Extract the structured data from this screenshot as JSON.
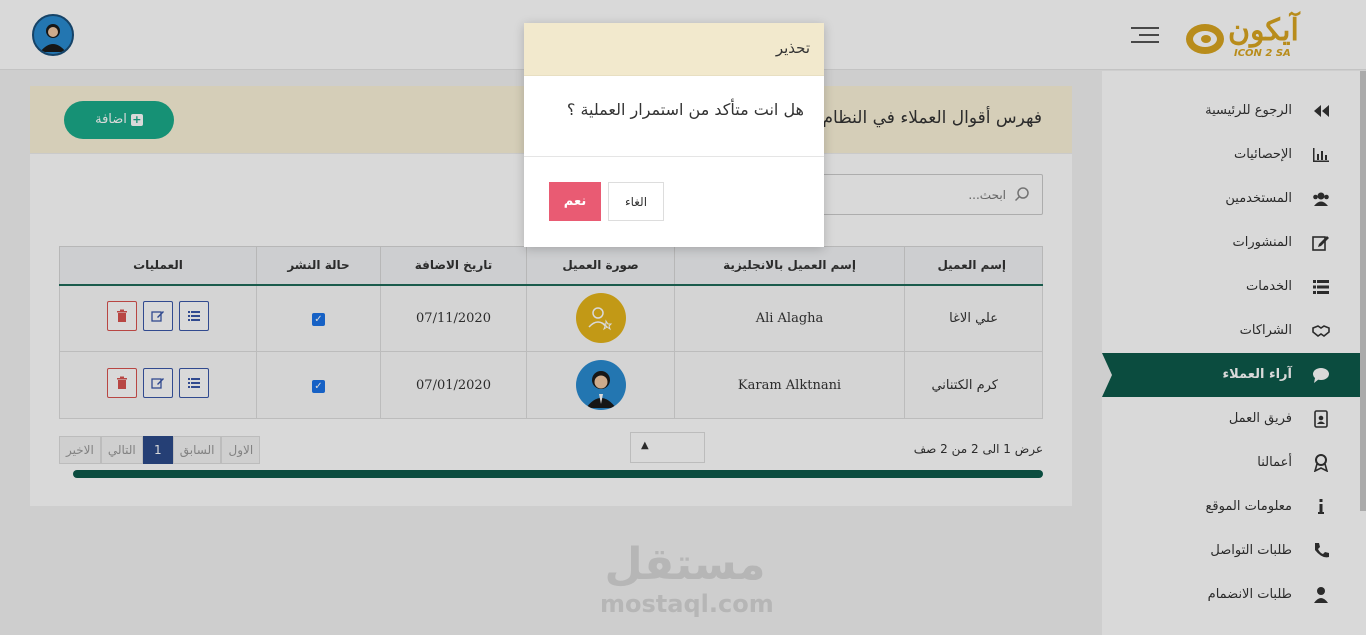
{
  "header": {
    "logo_text": "آيكون",
    "logo_sub": "ICON 2 SA"
  },
  "sidebar": {
    "items": [
      {
        "label": "الرجوع للرئيسية",
        "icon": "back-fast-icon"
      },
      {
        "label": "الإحصائيات",
        "icon": "bar-chart-icon"
      },
      {
        "label": "المستخدمين",
        "icon": "users-icon"
      },
      {
        "label": "المنشورات",
        "icon": "edit-square-icon"
      },
      {
        "label": "الخدمات",
        "icon": "list-icon"
      },
      {
        "label": "الشراكات",
        "icon": "handshake-icon"
      },
      {
        "label": "آراء العملاء",
        "icon": "comment-icon",
        "active": true
      },
      {
        "label": "فريق العمل",
        "icon": "id-badge-icon"
      },
      {
        "label": "أعمالنا",
        "icon": "award-icon"
      },
      {
        "label": "معلومات الموقع",
        "icon": "info-icon"
      },
      {
        "label": "طلبات التواصل",
        "icon": "phone-icon"
      },
      {
        "label": "طلبات الانضمام",
        "icon": "user-icon"
      }
    ]
  },
  "page": {
    "title": "فهرس أقوال العملاء في النظام",
    "add_label": "اضافة",
    "search_placeholder": "ابحث..."
  },
  "table": {
    "headers": [
      "إسم العميل",
      "إسم العميل بالانجليزية",
      "صورة العميل",
      "تاريخ الاضافة",
      "حالة النشر",
      "العمليات"
    ],
    "rows": [
      {
        "name": "علي الاغا",
        "name_en": "Ali Alagha",
        "image": "placeholder-avatar",
        "date": "07/11/2020",
        "published": true
      },
      {
        "name": "كرم الكتناني",
        "name_en": "Karam Alktnani",
        "image": "person-avatar",
        "date": "07/01/2020",
        "published": true
      }
    ]
  },
  "pagination": {
    "info": "عرض 1 الى 2 من 2 صف",
    "first": "الاول",
    "prev": "السابق",
    "current": "1",
    "next": "التالي",
    "last": "الاخير"
  },
  "watermark": {
    "arabic": "مستقل",
    "english": "mostaql.com"
  },
  "modal": {
    "title": "تحذير",
    "message": "هل انت متأكد من استمرار العملية ؟",
    "confirm": "نعم",
    "cancel": "الغاء"
  },
  "colors": {
    "accent": "#0e5a4a",
    "add_button": "#1bab8a",
    "confirm_button": "#e95b73",
    "header_bg": "#fbf3d9",
    "modal_header": "#f2e9cd"
  }
}
